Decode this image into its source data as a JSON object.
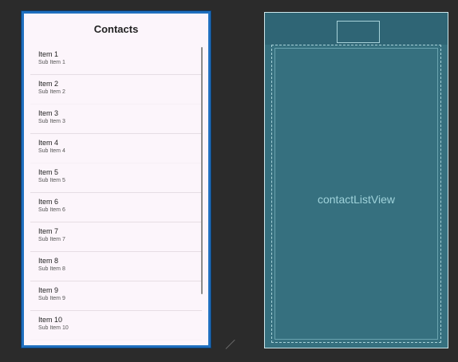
{
  "design": {
    "title": "Contacts",
    "items": [
      {
        "title": "Item 1",
        "subtitle": "Sub Item 1"
      },
      {
        "title": "Item 2",
        "subtitle": "Sub Item 2"
      },
      {
        "title": "Item 3",
        "subtitle": "Sub Item 3"
      },
      {
        "title": "Item 4",
        "subtitle": "Sub Item 4"
      },
      {
        "title": "Item 5",
        "subtitle": "Sub Item 5"
      },
      {
        "title": "Item 6",
        "subtitle": "Sub Item 6"
      },
      {
        "title": "Item 7",
        "subtitle": "Sub Item 7"
      },
      {
        "title": "Item 8",
        "subtitle": "Sub Item 8"
      },
      {
        "title": "Item 9",
        "subtitle": "Sub Item 9"
      },
      {
        "title": "Item 10",
        "subtitle": "Sub Item 10"
      }
    ]
  },
  "blueprint": {
    "list_view_id": "contactListView"
  },
  "colors": {
    "canvas_bg": "#2b2b2b",
    "phone_bg": "#fcf5fb",
    "phone_border": "#1f6fbf",
    "blueprint_bg": "#36707f",
    "blueprint_label": "#9fd2da"
  }
}
